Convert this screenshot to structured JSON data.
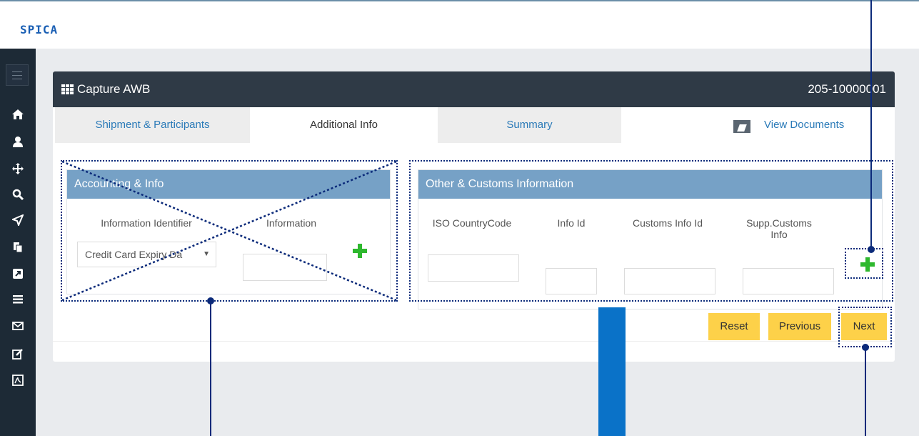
{
  "app": {
    "logo_text": "SPICA"
  },
  "header": {
    "title": "Capture AWB",
    "awb_number": "205-10000001"
  },
  "tabs": [
    {
      "label": "Shipment & Participants",
      "active": false
    },
    {
      "label": "Additional Info",
      "active": true
    },
    {
      "label": "Summary",
      "active": false
    }
  ],
  "view_documents": "View Documents",
  "accounting": {
    "title": "Accounting & Info",
    "col_identifier": "Information Identifier",
    "col_information": "Information",
    "identifier_value": "Credit Card Expiry Da",
    "information_value": ""
  },
  "customs": {
    "title": "Other & Customs Information",
    "col_iso": "ISO CountryCode",
    "col_info_id": "Info Id",
    "col_customs_info_id": "Customs Info Id",
    "col_supp_line1": "Supp.Customs",
    "col_supp_line2": "Info"
  },
  "buttons": {
    "reset": "Reset",
    "previous": "Previous",
    "next": "Next"
  },
  "colors": {
    "header": "#2f3a46",
    "section_head": "#76a1c6",
    "button": "#fdd149",
    "add": "#2eb82e",
    "annotation": "#0b2a7a",
    "sidebar": "#1d2a36"
  },
  "sidebar_icons": [
    "home-icon",
    "user-icon",
    "move-icon",
    "search-icon",
    "send-icon",
    "copy-icon",
    "external-link-icon",
    "list-icon",
    "envelope-icon",
    "edit-icon",
    "pdf-icon"
  ]
}
